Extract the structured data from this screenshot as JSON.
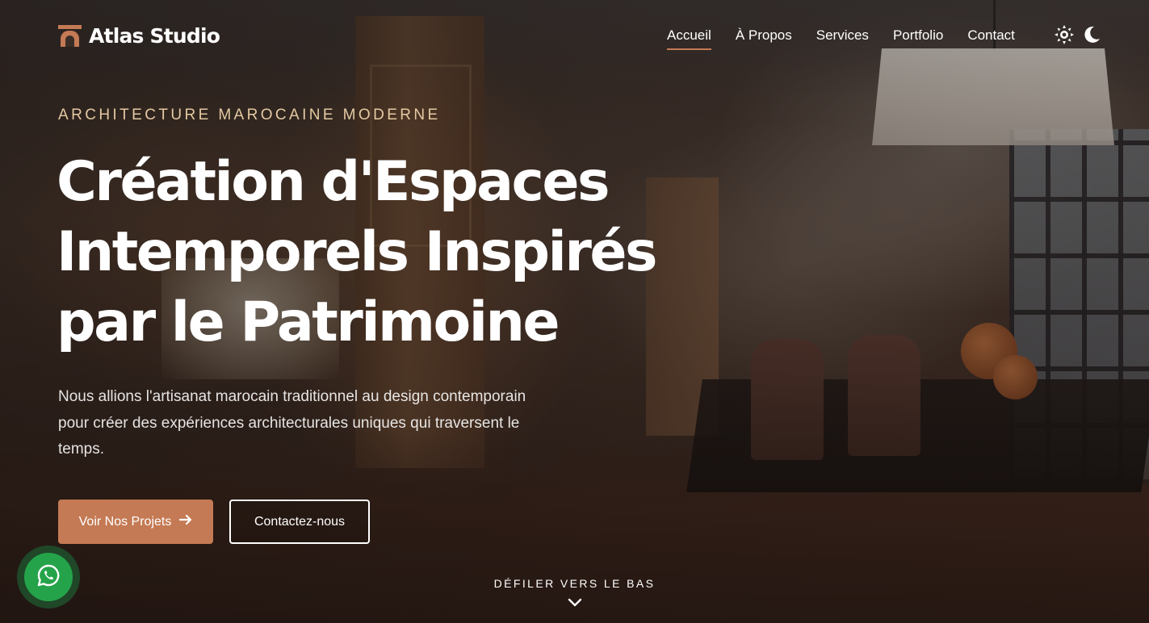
{
  "brand": {
    "name": "Atlas Studio",
    "accent": "#c47a54"
  },
  "nav": {
    "items": [
      {
        "label": "Accueil",
        "active": true
      },
      {
        "label": "À Propos",
        "active": false
      },
      {
        "label": "Services",
        "active": false
      },
      {
        "label": "Portfolio",
        "active": false
      },
      {
        "label": "Contact",
        "active": false
      }
    ]
  },
  "theme_toggle": {
    "icons": [
      "sun-icon",
      "moon-icon"
    ]
  },
  "hero": {
    "eyebrow": "ARCHITECTURE MAROCAINE MODERNE",
    "title_lines": [
      "Création d'Espaces",
      "Intemporels Inspirés",
      "par le Patrimoine"
    ],
    "description": "Nous allions l'artisanat marocain traditionnel au design contemporain pour créer des expériences architecturales uniques qui traversent le temps.",
    "primary_button": "Voir Nos Projets",
    "secondary_button": "Contactez-nous"
  },
  "scroll": {
    "label": "DÉFILER VERS LE BAS"
  },
  "floating": {
    "icon": "whatsapp-icon",
    "color": "#25a34a"
  }
}
